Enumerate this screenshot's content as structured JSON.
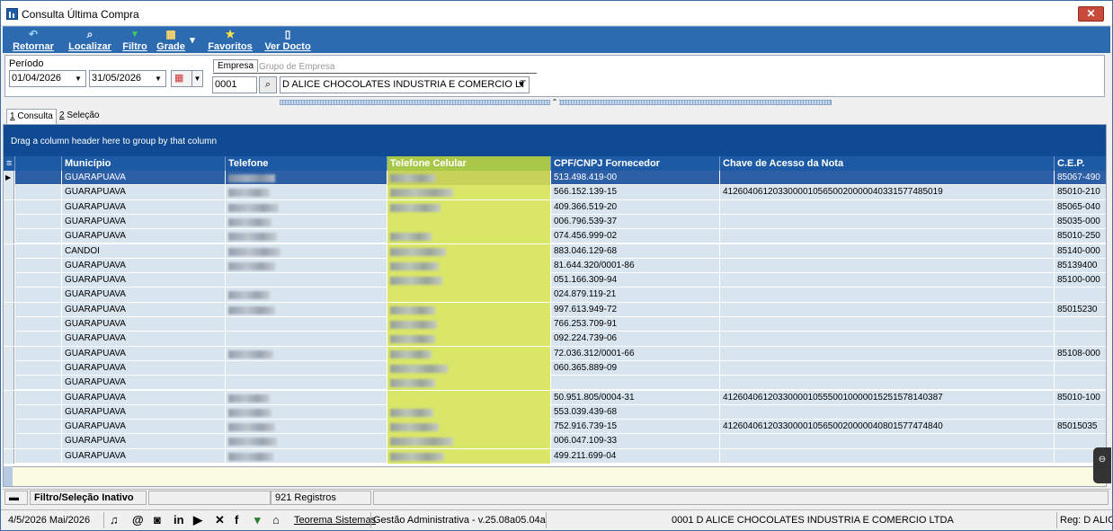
{
  "window": {
    "title": "Consulta Última Compra",
    "close_glyph": "✕"
  },
  "toolbar": {
    "items": [
      {
        "label": "Retornar",
        "icon": "undo-icon",
        "glyph": "↶",
        "color": "#7fc3ff"
      },
      {
        "label": "Localizar",
        "icon": "search-icon",
        "glyph": "🔍",
        "color": "#d8e8ff"
      },
      {
        "label": "Filtro",
        "icon": "filter-icon",
        "glyph": "▼",
        "color": "#3fcf5c"
      },
      {
        "label": "Grade",
        "icon": "grid-icon",
        "glyph": "▦",
        "color": "#ffd86b"
      },
      {
        "label": "Favoritos",
        "icon": "star-icon",
        "glyph": "★",
        "color": "#ffe14a"
      },
      {
        "label": "Ver Docto",
        "icon": "document-icon",
        "glyph": "▯",
        "color": "#ffffff"
      }
    ],
    "grade_dropdown_glyph": "▾"
  },
  "filter": {
    "periodo_label": "Período",
    "date_from": "01/04/2026",
    "date_to": "31/05/2026",
    "calendar_glyph": "▦",
    "empresa_tab": "Empresa",
    "grupo_tab": "Grupo de Empresa",
    "empresa_code": "0001",
    "empresa_name": "D ALICE CHOCOLATES INDUSTRIA E COMERCIO LT",
    "arrow_glyph": "▼",
    "search_glyph": "🔍"
  },
  "splitter_glyph": "⌃",
  "tabs": [
    {
      "num": "1",
      "label": " Consulta",
      "active": true
    },
    {
      "num": "2",
      "label": " Seleção",
      "active": false
    }
  ],
  "grid": {
    "group_hint": "Drag a column header here to group by that column",
    "columns": [
      "Município",
      "Telefone",
      "Telefone Celular",
      "CPF/CNPJ Fornecedor",
      "Chave de Acesso da Nota",
      "C.E.P."
    ],
    "colors": {
      "header": "#1c5aa6",
      "group_bar": "#0f4a93",
      "highlight_col": "#d9e667",
      "row": "#d8e5ef",
      "selected": "#2c5fa6"
    },
    "rows": [
      {
        "municipio": "GUARAPUAVA",
        "tel": 1,
        "cel": 1,
        "cpf": "513.498.419-00",
        "chave": "",
        "cep": "85067-490"
      },
      {
        "municipio": "GUARAPUAVA",
        "tel": 1,
        "cel": 1,
        "cpf": "566.152.139-15",
        "chave": "41260406120330000105650020000040331577485019",
        "cep": "85010-210"
      },
      {
        "municipio": "GUARAPUAVA",
        "tel": 1,
        "cel": 1,
        "cpf": "409.366.519-20",
        "chave": "",
        "cep": "85065-040"
      },
      {
        "municipio": "GUARAPUAVA",
        "tel": 1,
        "cel": 0,
        "cpf": "006.796.539-37",
        "chave": "",
        "cep": "85035-000"
      },
      {
        "municipio": "GUARAPUAVA",
        "tel": 1,
        "cel": 1,
        "cpf": "074.456.999-02",
        "chave": "",
        "cep": "85010-250"
      },
      {
        "municipio": "CANDOI",
        "tel": 1,
        "cel": 1,
        "cpf": "883.046.129-68",
        "chave": "",
        "cep": "85140-000"
      },
      {
        "municipio": "GUARAPUAVA",
        "tel": 1,
        "cel": 1,
        "cpf": "81.644.320/0001-86",
        "chave": "",
        "cep": "85139400"
      },
      {
        "municipio": "GUARAPUAVA",
        "tel": 0,
        "cel": 1,
        "cpf": "051.166.309-94",
        "chave": "",
        "cep": "85100-000"
      },
      {
        "municipio": "GUARAPUAVA",
        "tel": 1,
        "cel": 0,
        "cpf": "024.879.119-21",
        "chave": "",
        "cep": ""
      },
      {
        "municipio": "GUARAPUAVA",
        "tel": 1,
        "cel": 1,
        "cpf": "997.613.949-72",
        "chave": "",
        "cep": "85015230"
      },
      {
        "municipio": "GUARAPUAVA",
        "tel": 0,
        "cel": 1,
        "cpf": "766.253.709-91",
        "chave": "",
        "cep": ""
      },
      {
        "municipio": "GUARAPUAVA",
        "tel": 0,
        "cel": 1,
        "cpf": "092.224.739-06",
        "chave": "",
        "cep": ""
      },
      {
        "municipio": "GUARAPUAVA",
        "tel": 1,
        "cel": 1,
        "cpf": "72.036.312/0001-66",
        "chave": "",
        "cep": "85108-000"
      },
      {
        "municipio": "GUARAPUAVA",
        "tel": 0,
        "cel": 1,
        "cpf": "060.365.889-09",
        "chave": "",
        "cep": ""
      },
      {
        "municipio": "GUARAPUAVA",
        "tel": 0,
        "cel": 1,
        "cpf": "",
        "chave": "",
        "cep": ""
      },
      {
        "municipio": "GUARAPUAVA",
        "tel": 1,
        "cel": 0,
        "cpf": "50.951.805/0004-31",
        "chave": "41260406120330000105550010000015251578140387",
        "cep": "85010-100"
      },
      {
        "municipio": "GUARAPUAVA",
        "tel": 1,
        "cel": 1,
        "cpf": "553.039.439-68",
        "chave": "",
        "cep": ""
      },
      {
        "municipio": "GUARAPUAVA",
        "tel": 1,
        "cel": 1,
        "cpf": "752.916.739-15",
        "chave": "41260406120330000105650020000040801577474840",
        "cep": "85015035"
      },
      {
        "municipio": "GUARAPUAVA",
        "tel": 1,
        "cel": 1,
        "cpf": "006.047.109-33",
        "chave": "",
        "cep": ""
      },
      {
        "municipio": "GUARAPUAVA",
        "tel": 1,
        "cel": 1,
        "cpf": "499.211.699-04",
        "chave": "",
        "cep": ""
      }
    ]
  },
  "status": {
    "filtro": "Filtro/Seleção Inativo",
    "registros": "921 Registros"
  },
  "bottom": {
    "date": "4/5/2026 Mai/2026",
    "social_icons": [
      "headset-icon",
      "at-icon",
      "instagram-icon",
      "linkedin-icon",
      "youtube-icon",
      "x-icon",
      "facebook-icon",
      "tree-icon",
      "graduation-icon"
    ],
    "social_glyphs": [
      "🎧",
      "@",
      "◙",
      "in",
      "▶",
      "𝕏",
      "f",
      "✔",
      "🎓"
    ],
    "company_link": "Teorema Sistemas",
    "version": "Gestão Administrativa - v.25.08a05.04a",
    "empresa": "0001 D ALICE CHOCOLATES INDUSTRIA E COMERCIO LTDA",
    "reg": "Reg: D ALIC"
  }
}
